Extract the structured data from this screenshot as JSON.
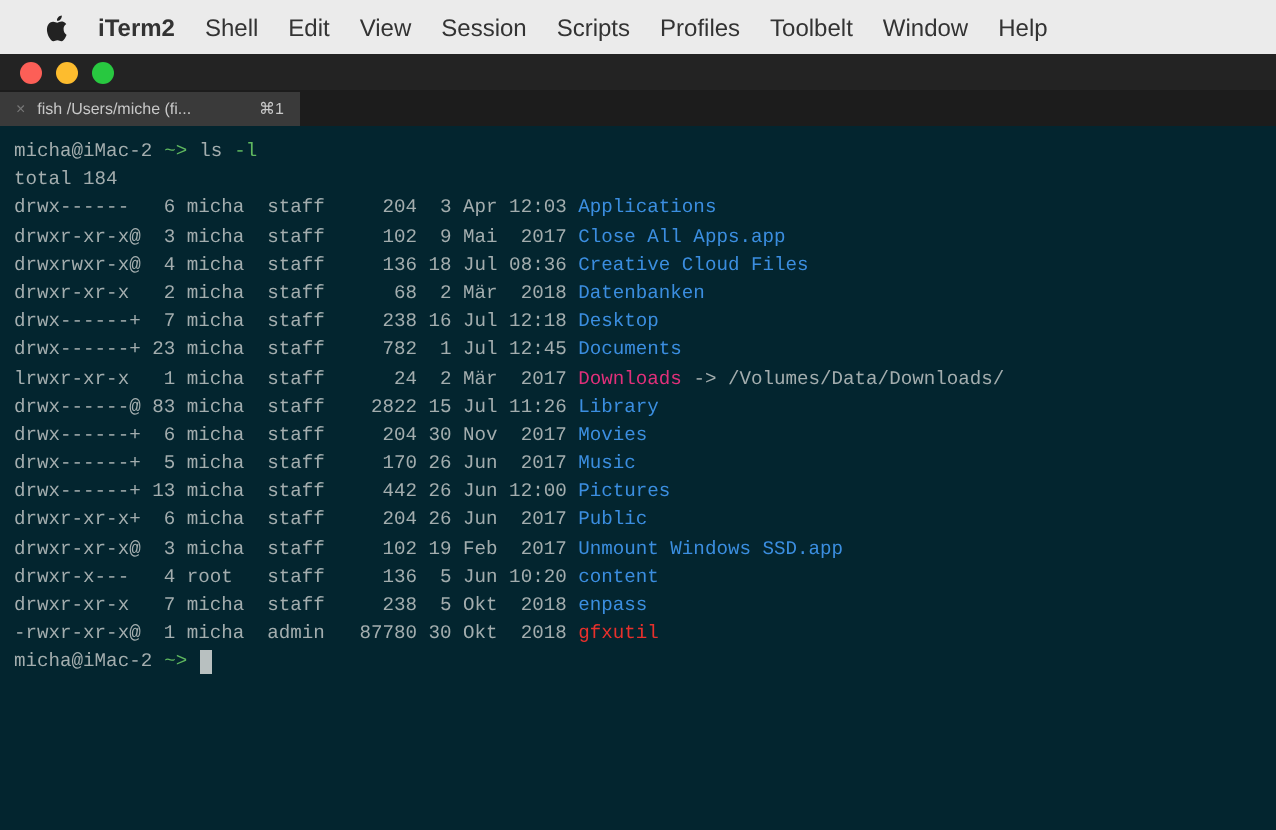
{
  "menu_bar": {
    "app_name": "iTerm2",
    "items": [
      "Shell",
      "Edit",
      "View",
      "Session",
      "Scripts",
      "Profiles",
      "Toolbelt",
      "Window",
      "Help"
    ]
  },
  "tab": {
    "close": "×",
    "title": "fish /Users/miche (fi...",
    "shortcut": "⌘1",
    "selected": true
  },
  "terminal": {
    "command_prompt": {
      "user_host": "micha@iMac-2",
      "arrow": "~>",
      "command": "ls",
      "argument": "-l"
    },
    "total": "total 184",
    "rows": [
      {
        "perms": "drwx------",
        "links": "6",
        "owner": "micha",
        "group": "staff",
        "size": "204",
        "date": "3 Apr 12:03",
        "name": "Applications",
        "kind": "dir"
      },
      {
        "perms": "drwxr-xr-x@",
        "links": "3",
        "owner": "micha",
        "group": "staff",
        "size": "102",
        "date": "9 Mai  2017",
        "name": "Close All Apps.app",
        "kind": "dir"
      },
      {
        "perms": "drwxrwxr-x@",
        "links": "4",
        "owner": "micha",
        "group": "staff",
        "size": "136",
        "date": "18 Jul 08:36",
        "name": "Creative Cloud Files",
        "kind": "dir"
      },
      {
        "perms": "drwxr-xr-x",
        "links": "2",
        "owner": "micha",
        "group": "staff",
        "size": "68",
        "date": "2 Mär  2018",
        "name": "Datenbanken",
        "kind": "dir"
      },
      {
        "perms": "drwx------+",
        "links": "7",
        "owner": "micha",
        "group": "staff",
        "size": "238",
        "date": "16 Jul 12:18",
        "name": "Desktop",
        "kind": "dir"
      },
      {
        "perms": "drwx------+",
        "links": "23",
        "owner": "micha",
        "group": "staff",
        "size": "782",
        "date": "1 Jul 12:45",
        "name": "Documents",
        "kind": "dir"
      },
      {
        "perms": "lrwxr-xr-x",
        "links": "1",
        "owner": "micha",
        "group": "staff",
        "size": "24",
        "date": "2 Mär  2017",
        "name": "Downloads",
        "kind": "link",
        "target": "-> /Volumes/Data/Downloads/"
      },
      {
        "perms": "drwx------@",
        "links": "83",
        "owner": "micha",
        "group": "staff",
        "size": "2822",
        "date": "15 Jul 11:26",
        "name": "Library",
        "kind": "dir"
      },
      {
        "perms": "drwx------+",
        "links": "6",
        "owner": "micha",
        "group": "staff",
        "size": "204",
        "date": "30 Nov  2017",
        "name": "Movies",
        "kind": "dir"
      },
      {
        "perms": "drwx------+",
        "links": "5",
        "owner": "micha",
        "group": "staff",
        "size": "170",
        "date": "26 Jun  2017",
        "name": "Music",
        "kind": "dir"
      },
      {
        "perms": "drwx------+",
        "links": "13",
        "owner": "micha",
        "group": "staff",
        "size": "442",
        "date": "26 Jun 12:00",
        "name": "Pictures",
        "kind": "dir"
      },
      {
        "perms": "drwxr-xr-x+",
        "links": "6",
        "owner": "micha",
        "group": "staff",
        "size": "204",
        "date": "26 Jun  2017",
        "name": "Public",
        "kind": "dir"
      },
      {
        "perms": "drwxr-xr-x@",
        "links": "3",
        "owner": "micha",
        "group": "staff",
        "size": "102",
        "date": "19 Feb  2017",
        "name": "Unmount Windows SSD.app",
        "kind": "dir"
      },
      {
        "perms": "drwxr-x---",
        "links": "4",
        "owner": "root",
        "group": "staff",
        "size": "136",
        "date": "5 Jun 10:20",
        "name": "content",
        "kind": "dir"
      },
      {
        "perms": "drwxr-xr-x",
        "links": "7",
        "owner": "micha",
        "group": "staff",
        "size": "238",
        "date": "5 Okt  2018",
        "name": "enpass",
        "kind": "dir"
      },
      {
        "perms": "-rwxr-xr-x@",
        "links": "1",
        "owner": "micha",
        "group": "admin",
        "size": "87780",
        "date": "30 Okt  2018",
        "name": "gfxutil",
        "kind": "exec"
      }
    ],
    "end_prompt": {
      "user_host": "micha@iMac-2",
      "arrow": "~>"
    }
  }
}
